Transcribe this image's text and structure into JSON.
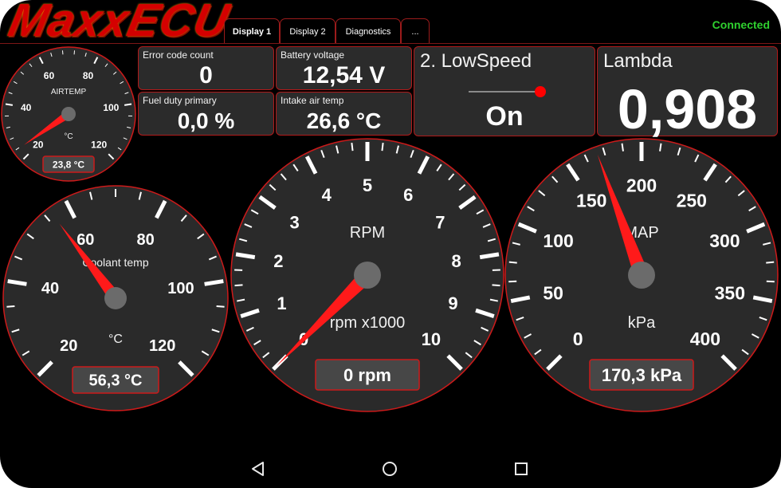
{
  "app": {
    "logo": "MaxxECU",
    "status": "Connected"
  },
  "tabs": [
    {
      "label": "Display 1",
      "active": true
    },
    {
      "label": "Display 2",
      "active": false
    },
    {
      "label": "Diagnostics",
      "active": false
    },
    {
      "label": "...",
      "active": false
    }
  ],
  "tiles": {
    "error_code_count": {
      "label": "Error code count",
      "value": "0"
    },
    "battery_voltage": {
      "label": "Battery voltage",
      "value": "12,54 V"
    },
    "fuel_duty_primary": {
      "label": "Fuel duty primary",
      "value": "0,0 %"
    },
    "intake_air_temp": {
      "label": "Intake air temp",
      "value": "26,6 °C"
    },
    "low_speed": {
      "label": "2. LowSpeed",
      "value": "On",
      "indicator_color": "#ff0000"
    },
    "lambda": {
      "label": "Lambda",
      "value": "0,908"
    }
  },
  "gauges": {
    "airtemp": {
      "title": "AIRTEMP",
      "unit": "°C",
      "readout": "23,8 °C",
      "value": 23.8,
      "min": 20,
      "max": 120,
      "labels": [
        "20",
        "40",
        "60",
        "80",
        "100",
        "120"
      ]
    },
    "coolant": {
      "title": "Coolant temp",
      "unit": "°C",
      "readout": "56,3 °C",
      "value": 56.3,
      "min": 20,
      "max": 120,
      "labels": [
        "20",
        "40",
        "60",
        "80",
        "100",
        "120"
      ]
    },
    "rpm": {
      "title": "RPM",
      "unit": "rpm x1000",
      "readout": "0 rpm",
      "value": 0,
      "min": 0,
      "max": 10,
      "labels": [
        "0",
        "1",
        "2",
        "3",
        "4",
        "5",
        "6",
        "7",
        "8",
        "9",
        "10"
      ]
    },
    "map": {
      "title": "MAP",
      "unit": "kPa",
      "readout": "170,3 kPa",
      "value": 170.3,
      "min": 0,
      "max": 400,
      "labels": [
        "0",
        "50",
        "100",
        "150",
        "200",
        "250",
        "300",
        "350",
        "400"
      ]
    }
  },
  "colors": {
    "accent": "#cc1a1a",
    "needle": "#ff1a1a",
    "status": "#2fd12f",
    "tile_bg": "#2b2b2b",
    "gauge_bg": "#2a2a2a"
  },
  "nav": {
    "back": "back-icon",
    "home": "home-icon",
    "recents": "recents-icon"
  }
}
